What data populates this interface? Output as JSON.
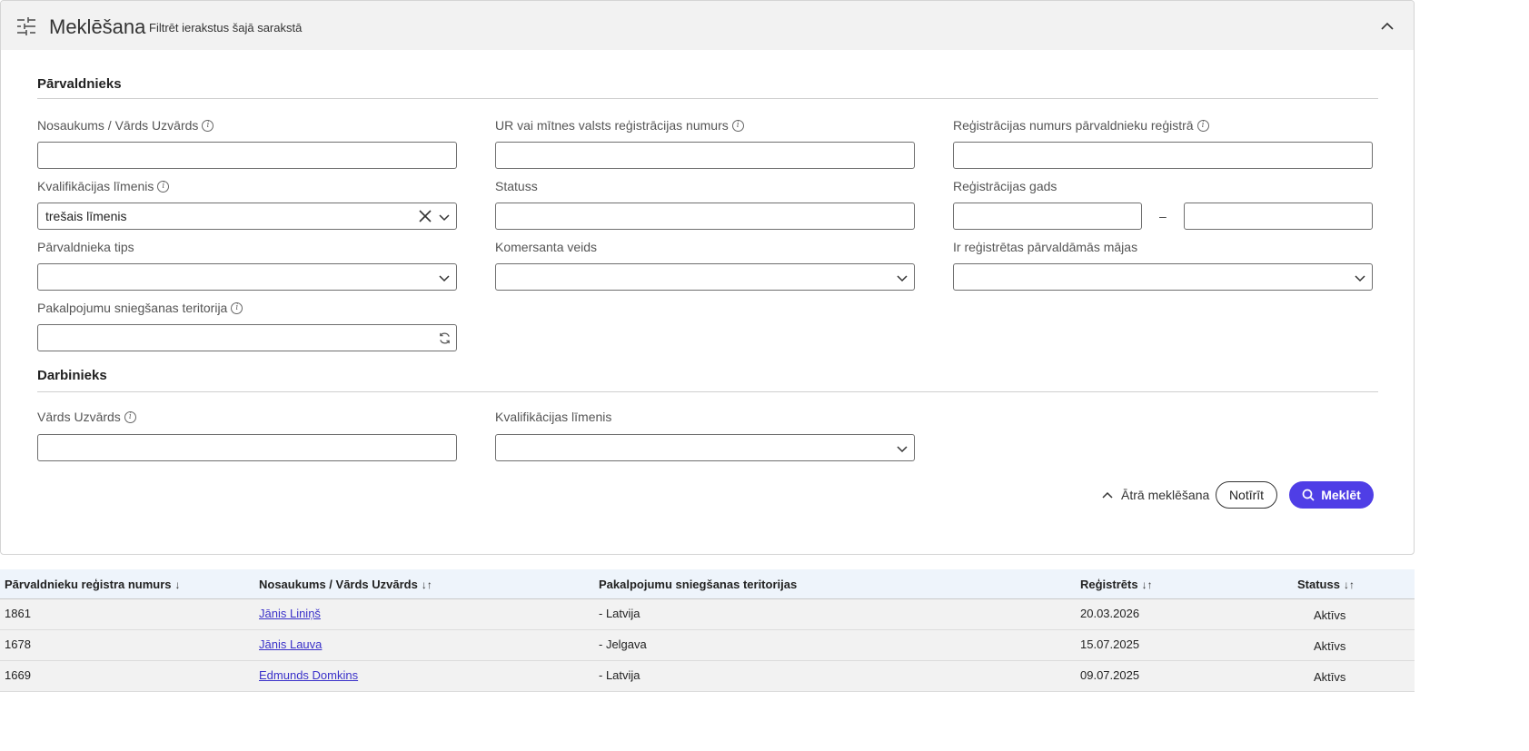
{
  "header": {
    "title": "Meklēšana",
    "subtitle": "Filtrēt ierakstus šajā sarakstā"
  },
  "sections": {
    "manager": "Pārvaldnieks",
    "employee": "Darbinieks"
  },
  "fields": {
    "name": {
      "label": "Nosaukums / Vārds Uzvārds",
      "value": ""
    },
    "ur_number": {
      "label": "UR vai mītnes valsts reģistrācijas numurs",
      "value": ""
    },
    "reg_number": {
      "label": "Reģistrācijas numurs pārvaldnieku reģistrā",
      "value": ""
    },
    "qualification": {
      "label": "Kvalifikācijas līmenis",
      "value": "trešais līmenis"
    },
    "status": {
      "label": "Statuss",
      "value": ""
    },
    "reg_year": {
      "label": "Reģistrācijas gads",
      "from": "",
      "to": "",
      "separator": "–"
    },
    "manager_type": {
      "label": "Pārvaldnieka tips",
      "value": ""
    },
    "merchant_type": {
      "label": "Komersanta veids",
      "value": ""
    },
    "houses": {
      "label": "Ir reģistrētas pārvaldāmās mājas",
      "value": ""
    },
    "territory": {
      "label": "Pakalpojumu sniegšanas teritorija",
      "value": ""
    },
    "employee_name": {
      "label": "Vārds Uzvārds",
      "value": ""
    },
    "employee_qualification": {
      "label": "Kvalifikācijas līmenis",
      "value": ""
    }
  },
  "actions": {
    "quick_search": "Ātrā meklēšana",
    "clear": "Notīrīt",
    "search": "Meklēt"
  },
  "table": {
    "columns": [
      {
        "label": "Pārvaldnieku reģistra numurs",
        "sort": "↓"
      },
      {
        "label": "Nosaukums / Vārds Uzvārds",
        "sort": "↓↑"
      },
      {
        "label": "Pakalpojumu sniegšanas teritorijas",
        "sort": ""
      },
      {
        "label": "Reģistrēts",
        "sort": "↓↑"
      },
      {
        "label": "Statuss",
        "sort": "↓↑"
      }
    ],
    "rows": [
      {
        "number": "1861",
        "name": "Jānis Liniņš",
        "territory": "- Latvija",
        "registered": "20.03.2026",
        "status": "Aktīvs"
      },
      {
        "number": "1678",
        "name": "Jānis Lauva",
        "territory": "- Jelgava",
        "registered": "15.07.2025",
        "status": "Aktīvs"
      },
      {
        "number": "1669",
        "name": "Edmunds Domkins",
        "territory": "- Latvija",
        "registered": "09.07.2025",
        "status": "Aktīvs"
      }
    ]
  }
}
